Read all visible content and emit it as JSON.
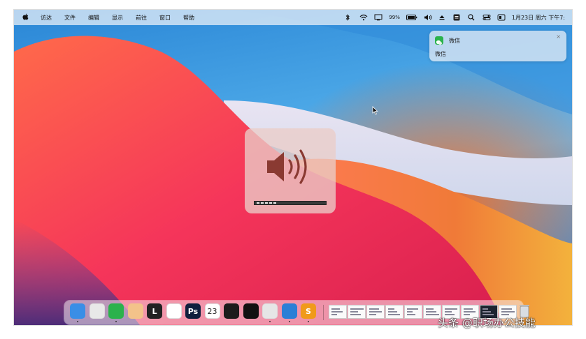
{
  "menubar": {
    "apple_glyph": "",
    "items": [
      "访达",
      "文件",
      "编辑",
      "显示",
      "前往",
      "窗口",
      "帮助"
    ],
    "battery_text": "99%",
    "datetime": "1月23日 周六 下午7:"
  },
  "notification": {
    "app_name": "微信",
    "body": "微信",
    "close_glyph": "×"
  },
  "volume": {
    "level": 0.32
  },
  "dock": {
    "apps": [
      {
        "name": "finder-app",
        "label": "",
        "color": "#3a8ee6",
        "running": true
      },
      {
        "name": "launchpad-app",
        "label": "",
        "color": "#e8e8e8",
        "running": false
      },
      {
        "name": "wechat-app",
        "label": "",
        "color": "#2bb24c",
        "running": true
      },
      {
        "name": "app-4",
        "label": "",
        "color": "#f3c38a",
        "running": false
      },
      {
        "name": "app-l",
        "label": "L",
        "color": "#222222",
        "running": false
      },
      {
        "name": "qq-app",
        "label": "",
        "color": "#ffffff",
        "running": false
      },
      {
        "name": "photoshop-app",
        "label": "Ps",
        "color": "#0f1f3d",
        "running": false
      },
      {
        "name": "calendar-app",
        "label": "23",
        "color": "#ffffff",
        "running": false
      },
      {
        "name": "clock-app",
        "label": "",
        "color": "#1c1c1c",
        "running": false
      },
      {
        "name": "capcut-app",
        "label": "",
        "color": "#111111",
        "running": false
      },
      {
        "name": "app-11",
        "label": "",
        "color": "#e6e6e6",
        "running": true
      },
      {
        "name": "app-12",
        "label": "",
        "color": "#2a7fd6",
        "running": true
      },
      {
        "name": "sublime-app",
        "label": "S",
        "color": "#f09a1a",
        "running": true
      }
    ],
    "accent": "#2bb24c"
  },
  "watermark": "头条 @职场办公技能"
}
